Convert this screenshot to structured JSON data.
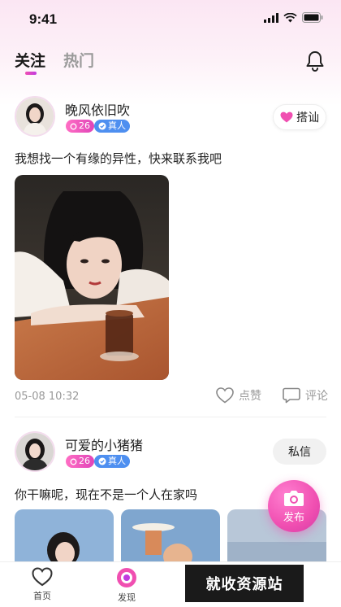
{
  "status": {
    "time": "9:41"
  },
  "tabs": [
    {
      "label": "关注",
      "active": true
    },
    {
      "label": "热门",
      "active": false
    }
  ],
  "posts": [
    {
      "username": "晚风依旧吹",
      "age": "26",
      "verified_label": "真人",
      "action_label": "搭讪",
      "text": "我想找一个有缘的异性，快来联系我吧",
      "timestamp": "05-08 10:32",
      "like_label": "点赞",
      "comment_label": "评论"
    },
    {
      "username": "可爱的小猪猪",
      "age": "26",
      "verified_label": "真人",
      "action_label": "私信",
      "text": "你干嘛呢，现在不是一个人在家吗"
    }
  ],
  "fab": {
    "label": "发布"
  },
  "nav": [
    {
      "label": "首页",
      "icon": "heart-icon"
    },
    {
      "label": "发现",
      "icon": "discover-icon"
    }
  ],
  "watermark": {
    "text": "就收资源站"
  },
  "colors": {
    "accent": "#f04fb1",
    "verified": "#4e8ff0"
  }
}
